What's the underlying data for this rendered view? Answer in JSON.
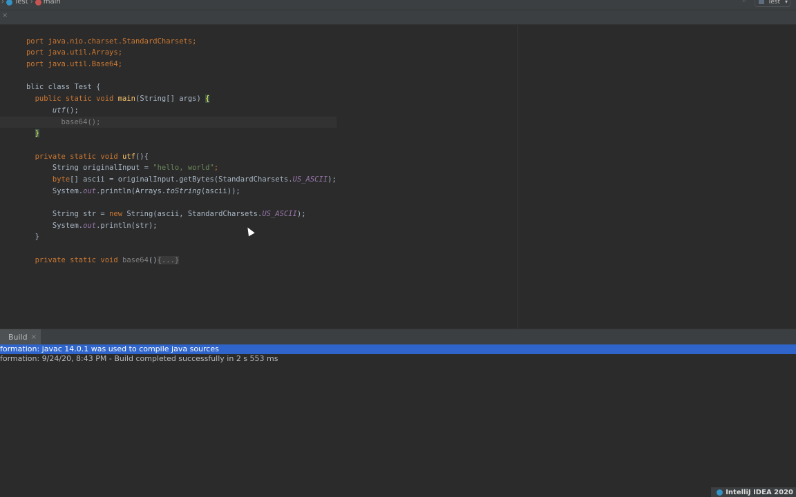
{
  "breadcrumb": {
    "class_name": "Test",
    "method_name": "main"
  },
  "run_config": {
    "label": "Test"
  },
  "editor": {
    "lines": [
      [
        "port java.nio.charset.StandardCharsets;"
      ],
      [
        "port java.util.Arrays;"
      ],
      [
        "port java.util.Base64;"
      ],
      [
        ""
      ],
      [
        "blic class Test {"
      ],
      [
        "  public static void ",
        "main",
        "(String[] args) ",
        "{"
      ],
      [
        "      ",
        "utf",
        "();"
      ],
      [
        "        base64();"
      ],
      [
        "  ",
        "}"
      ],
      [
        ""
      ],
      [
        "  private static void ",
        "utf",
        "(){"
      ],
      [
        "      String originalInput = ",
        "\"hello, world\"",
        ";"
      ],
      [
        "      ",
        "byte",
        "[] ascii = originalInput.getBytes(StandardCharsets.",
        "US_ASCII",
        ");"
      ],
      [
        "      System.",
        "out",
        ".println(Arrays.",
        "toString",
        "(ascii));"
      ],
      [
        ""
      ],
      [
        "      String str = ",
        "new",
        " String(ascii, StandardCharsets.",
        "US_ASCII",
        ");"
      ],
      [
        "      System.",
        "out",
        ".println(str);"
      ],
      [
        "  }"
      ],
      [
        ""
      ],
      [
        "  private static void ",
        "base64",
        "()",
        "{...}"
      ]
    ]
  },
  "build": {
    "tab_label": "Build",
    "output": [
      "formation: javac 14.0.1 was used to compile java sources",
      "formation: 9/24/20, 8:43 PM - Build completed successfully in 2 s 553 ms"
    ]
  },
  "status": {
    "notification": "IntelliJ IDEA 2020"
  }
}
